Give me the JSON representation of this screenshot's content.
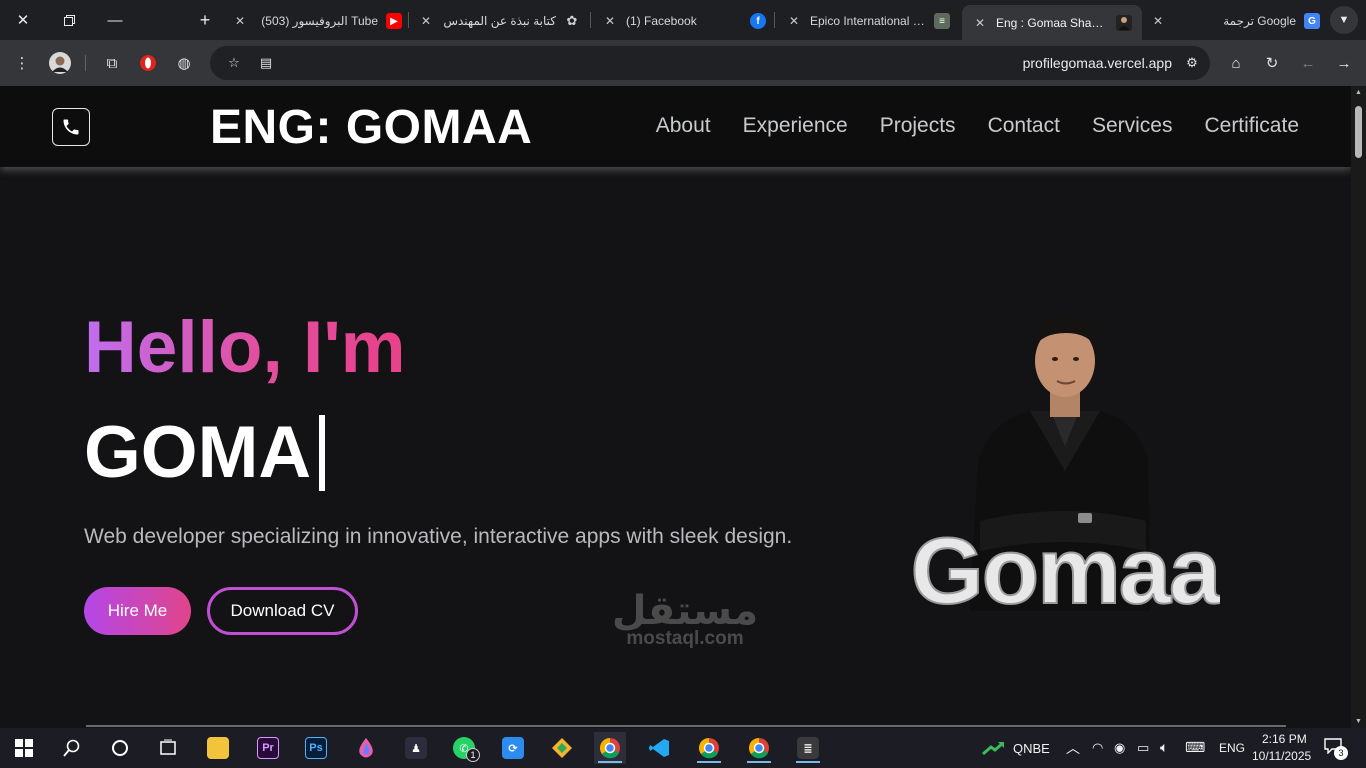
{
  "browser": {
    "tabs": [
      {
        "title": "البروفيسور (503) Tube",
        "favicon": "youtube-icon",
        "color": "#ff0000"
      },
      {
        "title": "كتابة نبذة عن المهندس",
        "favicon": "chatgpt-icon",
        "color": "#9aa0a6"
      },
      {
        "title": "(1) Facebook",
        "favicon": "facebook-icon",
        "color": "#1877f2"
      },
      {
        "title": "Epico International Gr",
        "favicon": "epico-icon",
        "color": "#6b8e6b"
      },
      {
        "title": "Eng : Gomaa Shaban",
        "favicon": "profile-icon",
        "color": "#444"
      },
      {
        "title": "ترجمة Google",
        "favicon": "google-translate-icon",
        "color": "#4285f4"
      }
    ],
    "url": "profilegomaa.vercel.app"
  },
  "site": {
    "brand": "ENG: GOMAA",
    "nav": [
      "About",
      "Experience",
      "Projects",
      "Contact",
      "Services",
      "Certificate"
    ],
    "hero": {
      "greeting": "Hello, I'm",
      "typed_name": "GOMA",
      "tagline": "Web developer specializing in innovative, interactive apps with sleek design.",
      "hire_button": "Hire Me",
      "cv_button": "Download CV",
      "portrait_text": "Gomaa"
    },
    "accent_gradient": [
      "#c06ef0",
      "#e8418a"
    ]
  },
  "watermark": {
    "arabic": "مستقل",
    "latin": "mostaql.com"
  },
  "taskbar": {
    "stock": "QNBE",
    "language": "ENG",
    "time": "2:16 PM",
    "date": "10/11/2025",
    "notifications": "3",
    "whatsapp_badge": "1"
  }
}
